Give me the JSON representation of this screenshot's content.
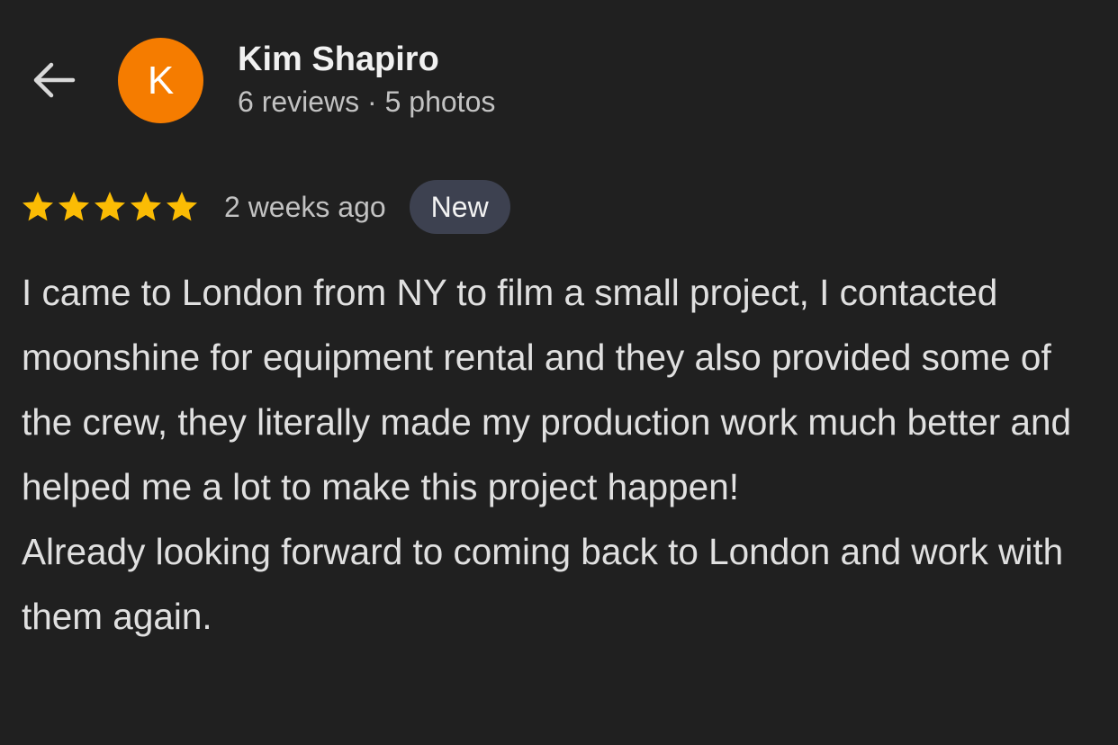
{
  "colors": {
    "background": "#202020",
    "avatar_bg": "#f57c00",
    "star": "#fbbc04",
    "badge_bg": "#3d4150",
    "text_primary": "#f1f1f1",
    "text_secondary": "#c2c2c2"
  },
  "header": {
    "back_icon": "arrow-back-icon",
    "avatar_initial": "K",
    "name": "Kim Shapiro",
    "stats": "6 reviews · 5 photos"
  },
  "review": {
    "rating": 5,
    "max_rating": 5,
    "time_ago": "2 weeks ago",
    "badge": "New",
    "paragraphs": [
      "I came to London from NY to film a small project, I contacted moonshine for equipment rental and they also provided some of the crew, they literally made my production work much better and helped me a lot to make this project happen!",
      "Already looking forward to coming back to London and work with them again."
    ]
  }
}
